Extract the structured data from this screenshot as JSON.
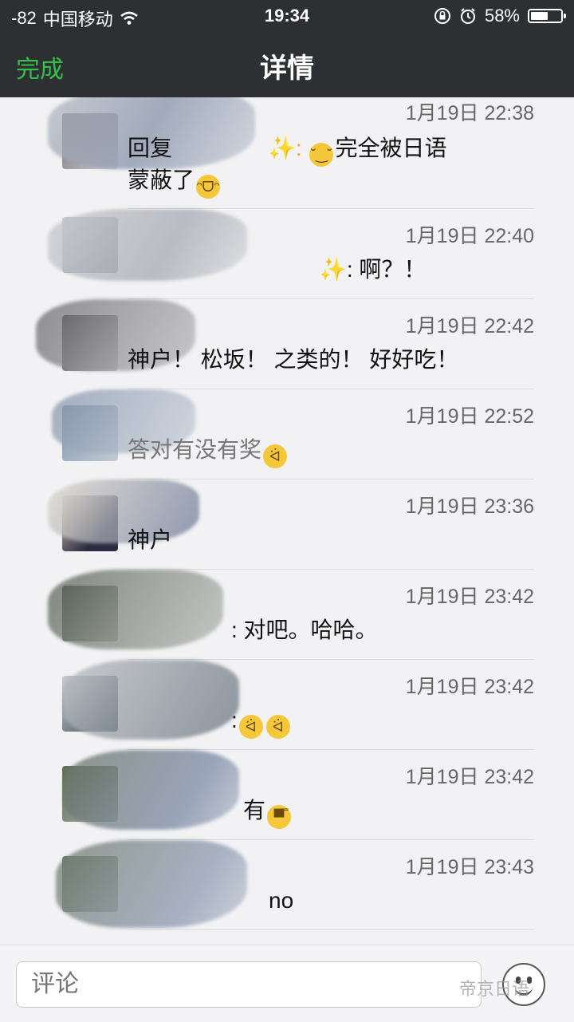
{
  "status_bar": {
    "signal": "-82",
    "carrier": "中国移动",
    "time": "19:34",
    "battery": "58%",
    "battery_level": 0.58
  },
  "nav": {
    "done": "完成",
    "title": "详情"
  },
  "rows": [
    {
      "time": "1月19日 22:38",
      "line1": "回复",
      "line1b": "✨: ",
      "line1c": "完全被日语",
      "line2": "蒙蔽了",
      "emoji": "😁"
    },
    {
      "time": "1月19日 22:40",
      "text": "✨: 啊？！"
    },
    {
      "time": "1月19日 22:42",
      "text": "神户！ 松坂！ 之类的！ 好好吃！"
    },
    {
      "time": "1月19日 22:52",
      "text": "答对有没有奖"
    },
    {
      "time": "1月19日 23:36",
      "text": "神户"
    },
    {
      "time": "1月19日 23:42",
      "text": ": 对吧。哈哈。"
    },
    {
      "time": "1月19日 23:42",
      "text": ":"
    },
    {
      "time": "1月19日 23:42",
      "text": "有"
    },
    {
      "time": "1月19日 23:43",
      "text": "no"
    }
  ],
  "comment": {
    "placeholder": "评论"
  },
  "watermark": "帝京日语",
  "colors": {
    "nav_bg": "#2e2f33",
    "done": "#31c24a"
  }
}
